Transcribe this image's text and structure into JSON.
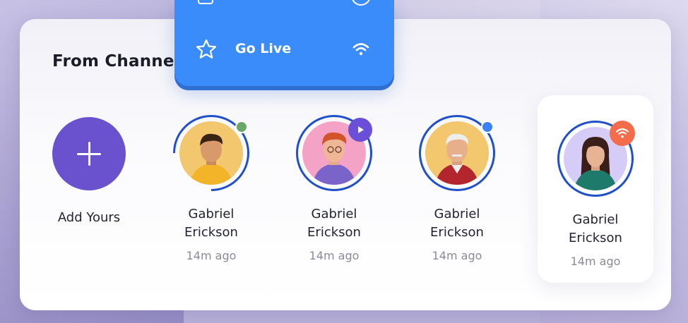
{
  "section": {
    "title": "From Channels"
  },
  "menu": {
    "item": {
      "label": "Go Live",
      "icon": "star-icon",
      "trailing_icon": "wifi-icon"
    }
  },
  "add_story": {
    "label": "Add Yours",
    "icon": "plus-icon"
  },
  "stories": [
    {
      "name": "Gabriel\nErickson",
      "time": "14m ago",
      "status": "online",
      "status_color": "#6aa86a"
    },
    {
      "name": "Gabriel\nErickson",
      "time": "14m ago",
      "status": "video",
      "status_color": "#6c4fd8"
    },
    {
      "name": "Gabriel\nErickson",
      "time": "14m ago",
      "status": "online",
      "status_color": "#3b82f6"
    },
    {
      "name": "Gabriel\nErickson",
      "time": "14m ago",
      "status": "live",
      "status_color": "#f46c4a"
    }
  ],
  "colors": {
    "accent_blue": "#3b8cfb",
    "ring": "#1f50c7",
    "add_purple": "#6a52cf"
  }
}
